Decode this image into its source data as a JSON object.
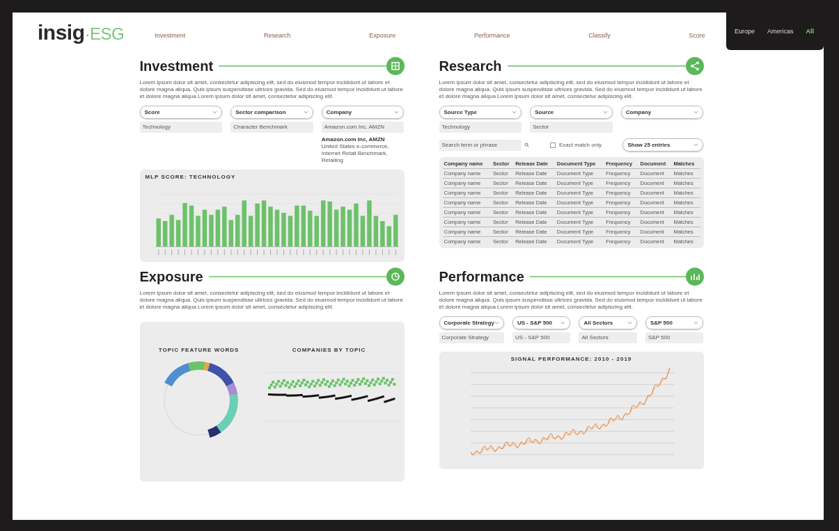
{
  "header": {
    "logo": {
      "word": "insig",
      "suffix": "·ESG"
    },
    "nav": [
      {
        "label": "Investment"
      },
      {
        "label": "Research"
      },
      {
        "label": "Exposure"
      },
      {
        "label": "Performance"
      },
      {
        "label": "Classify"
      },
      {
        "label": "Score"
      }
    ],
    "regions": [
      {
        "label": "Europe",
        "selected": false
      },
      {
        "label": "Americas",
        "selected": false
      },
      {
        "label": "All",
        "selected": true
      }
    ]
  },
  "sections": [
    {
      "kind": "investment",
      "title": "Investment",
      "description": "Lorem ipsum dolor sit amet, consectetur adipiscing elit, sed do eiusmod tempor incididunt ut labore et dolore magna aliqua. Quis ipsum suspendisse ultrices gravida. Sed do eiusmod tempor incididunt ut labore et dolore magna aliqua Lorem ipsum dolor sit amet, consectetur adipiscing elit.",
      "filters": [
        {
          "label": "Score",
          "value": "Technology"
        },
        {
          "label": "Sector comparison",
          "value": "Character Benchmark"
        },
        {
          "label": "Company",
          "value": "Amazon.com Inc. AMZN",
          "note": {
            "name": "Amazon.com Inc, AMZN",
            "details": "United States e-commerce, Internet Retail Benchmark, Retailing"
          }
        }
      ],
      "charts": [
        {
          "kind": "bars",
          "title": "MLP SCORE: TECHNOLOGY"
        }
      ]
    },
    {
      "kind": "research",
      "title": "Research",
      "description": "Lorem ipsum dolor sit amet, consectetur adipiscing elit, sed do eiusmod tempor incididunt ut labore et dolore magna aliqua. Quis ipsum suspendisse ultrices gravida. Sed do eiusmod tempor incididunt ut labore et dolore magna aliqua Lorem ipsum dolor sit amet, consectetur adipiscing elit.",
      "filters": [
        {
          "label": "Source Type",
          "value": "Technology"
        },
        {
          "label": "Source",
          "value": "Sector"
        },
        {
          "label": "Company"
        }
      ],
      "search": {
        "placeholder": "Search term or phrase"
      },
      "exact_match": {
        "label": "Exact match only",
        "checked": false
      },
      "entries": {
        "label": "Show 25 entries"
      },
      "table": {
        "columns": [
          "Company name",
          "Sector",
          "Release Date",
          "Document Type",
          "Frequency",
          "Document",
          "Matches"
        ],
        "rows": [
          [
            "Company name",
            "Sector",
            "Release Date",
            "Document Type",
            "Frequency",
            "Document",
            "Matches"
          ],
          [
            "Company name",
            "Sector",
            "Release Date",
            "Document Type",
            "Frequency",
            "Document",
            "Matches"
          ],
          [
            "Company name",
            "Sector",
            "Release Date",
            "Document Type",
            "Frequency",
            "Document",
            "Matches"
          ],
          [
            "Company name",
            "Sector",
            "Release Date",
            "Document Type",
            "Frequency",
            "Document",
            "Matches"
          ],
          [
            "Company name",
            "Sector",
            "Release Date",
            "Document Type",
            "Frequency",
            "Document",
            "Matches"
          ],
          [
            "Company name",
            "Sector",
            "Release Date",
            "Document Type",
            "Frequency",
            "Document",
            "Matches"
          ],
          [
            "Company name",
            "Sector",
            "Release Date",
            "Document Type",
            "Frequency",
            "Document",
            "Matches"
          ],
          [
            "Company name",
            "Sector",
            "Release Date",
            "Document Type",
            "Frequency",
            "Document",
            "Matches"
          ]
        ]
      }
    },
    {
      "kind": "exposure",
      "title": "Exposure",
      "description": "Lorem ipsum dolor sit amet, consectetur adipiscing elit, sed do eiusmod tempor incididunt ut labore et dolore magna aliqua. Quis ipsum suspendisse ultrices gravida. Sed do eiusmod tempor incididunt ut labore et dolore magna aliqua Lorem ipsum dolor sit amet, consectetur adipiscing elit.",
      "charts": [
        {
          "kind": "donut",
          "title": "TOPIC FEATURE WORDS"
        },
        {
          "kind": "scatter",
          "title": "COMPANIES BY TOPIC"
        }
      ]
    },
    {
      "kind": "performance",
      "title": "Performance",
      "description": "Lorem ipsum dolor sit amet, consectetur adipiscing elit, sed do eiusmod tempor incididunt ut labore et dolore magna aliqua. Quis ipsum suspendisse ultrices gravida. Sed do eiusmod tempor incididunt ut labore et dolore magna aliqua Lorem ipsum dolor sit amet, consectetur adipiscing elit.",
      "filters": [
        {
          "label": "Corporate Strategy",
          "value": "Corporate Strategy"
        },
        {
          "label": "US - S&P 500",
          "value": "US - S&P 500"
        },
        {
          "label": "All Sectors",
          "value": "All Sectors"
        },
        {
          "label": "S&P 500",
          "value": "S&P 500"
        }
      ],
      "charts": [
        {
          "kind": "line",
          "title": "SIGNAL PERFORMANCE: 2010 - 2019"
        }
      ]
    }
  ]
}
